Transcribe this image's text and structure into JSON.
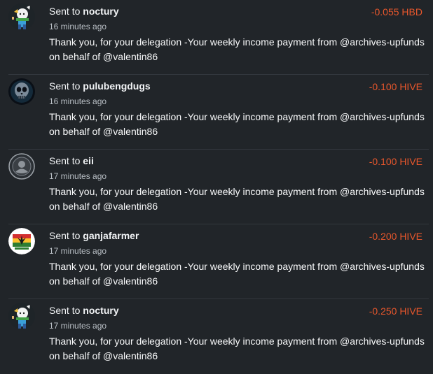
{
  "transactions": [
    {
      "prefix": "Sent to ",
      "user": "noctury",
      "time": "16 minutes ago",
      "amount": "-0.055 HBD",
      "memo": "Thank you, for your delegation -Your weekly income payment from @archives-upfunds on behalf of @valentin86",
      "avatar": "noctury-avatar"
    },
    {
      "prefix": "Sent to ",
      "user": "pulubengdugs",
      "time": "16 minutes ago",
      "amount": "-0.100 HIVE",
      "memo": "Thank you, for your delegation -Your weekly income payment from @archives-upfunds on behalf of @valentin86",
      "avatar": "skull-avatar"
    },
    {
      "prefix": "Sent to ",
      "user": "eii",
      "time": "17 minutes ago",
      "amount": "-0.100 HIVE",
      "memo": "Thank you, for your delegation -Your weekly income payment from @archives-upfunds on behalf of @valentin86",
      "avatar": "default-avatar"
    },
    {
      "prefix": "Sent to ",
      "user": "ganjafarmer",
      "time": "17 minutes ago",
      "amount": "-0.200 HIVE",
      "memo": "Thank you, for your delegation -Your weekly income payment from @archives-upfunds on behalf of @valentin86",
      "avatar": "ganja-avatar"
    },
    {
      "prefix": "Sent to ",
      "user": "noctury",
      "time": "17 minutes ago",
      "amount": "-0.250 HIVE",
      "memo": "Thank you, for your delegation -Your weekly income payment from @archives-upfunds on behalf of @valentin86",
      "avatar": "noctury-avatar"
    }
  ],
  "colors": {
    "background": "#212529",
    "amount": "#e8572c",
    "separator": "#33383e"
  }
}
